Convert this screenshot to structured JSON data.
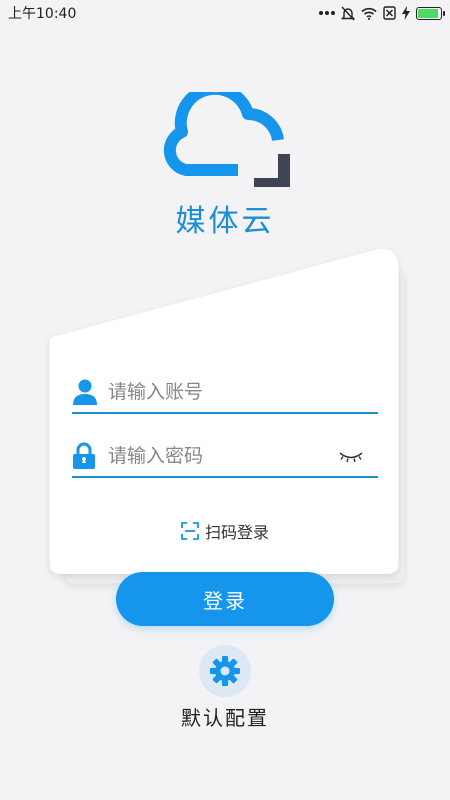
{
  "status_bar": {
    "time": "上午10:40",
    "icons": [
      "more-dots-icon",
      "mute-bell-icon",
      "wifi-icon",
      "no-sim-icon",
      "charging-icon",
      "battery-icon"
    ],
    "battery_level": 0.9,
    "battery_color": "#4cd964"
  },
  "app": {
    "name": "媒体云",
    "brand_color": "#1a8fd6",
    "logo_dark_color": "#3e4452"
  },
  "login_form": {
    "account_placeholder": "请输入账号",
    "account_value": "",
    "password_placeholder": "请输入密码",
    "password_value": "",
    "qr_login_label": "扫码登录",
    "submit_label": "登录"
  },
  "config": {
    "label": "默认配置"
  }
}
